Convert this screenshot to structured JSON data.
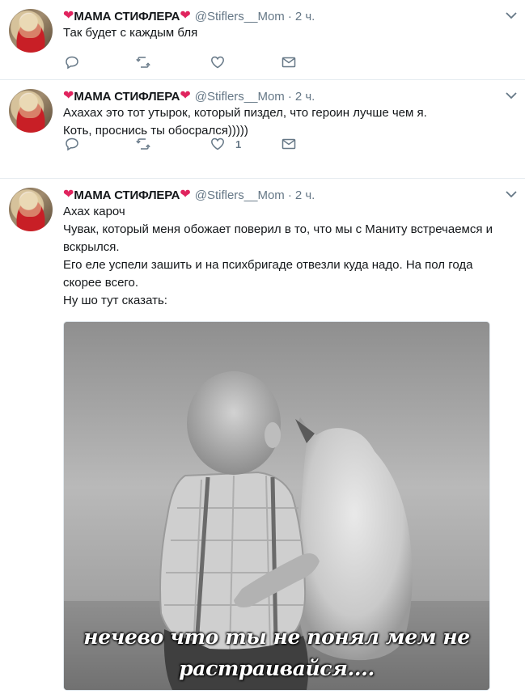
{
  "tweets": [
    {
      "name": "МАМА СТИФЛЕРА",
      "handle": "@Stiflers__Mom",
      "dot": "·",
      "time": "2 ч.",
      "lines": [
        "Так будет с каждым бля"
      ],
      "likes": ""
    },
    {
      "name": "МАМА СТИФЛЕРА",
      "handle": "@Stiflers__Mom",
      "dot": "·",
      "time": "2 ч.",
      "lines": [
        "Ахахах это тот утырок, который пиздел, что героин лучше чем я.",
        "Коть, проснись ты обосрался)))))"
      ],
      "likes": "1"
    },
    {
      "name": "МАМА СТИФЛЕРА",
      "handle": "@Stiflers__Mom",
      "dot": "·",
      "time": "2 ч.",
      "lines": [
        "Ахах кароч",
        "Чувак, который меня обожает поверил в то, что мы с Маниту встречаемся и вскрылся.",
        "Его еле успели зашить и на психбригаде отвезли куда надо. На пол года скорее всего.",
        "Ну шо тут сказать:"
      ],
      "image_caption": [
        "нечево что ты не понял мем не",
        "растраивайся...."
      ]
    }
  ],
  "icons": {
    "heart_emoji": "❤",
    "reply": "reply-icon",
    "retweet": "retweet-icon",
    "like": "like-icon",
    "dm": "message-icon",
    "more": "chevron-down-icon"
  },
  "colors": {
    "text": "#14171a",
    "secondary": "#657786",
    "heart": "#e0245e",
    "divider": "#e6ecf0"
  }
}
